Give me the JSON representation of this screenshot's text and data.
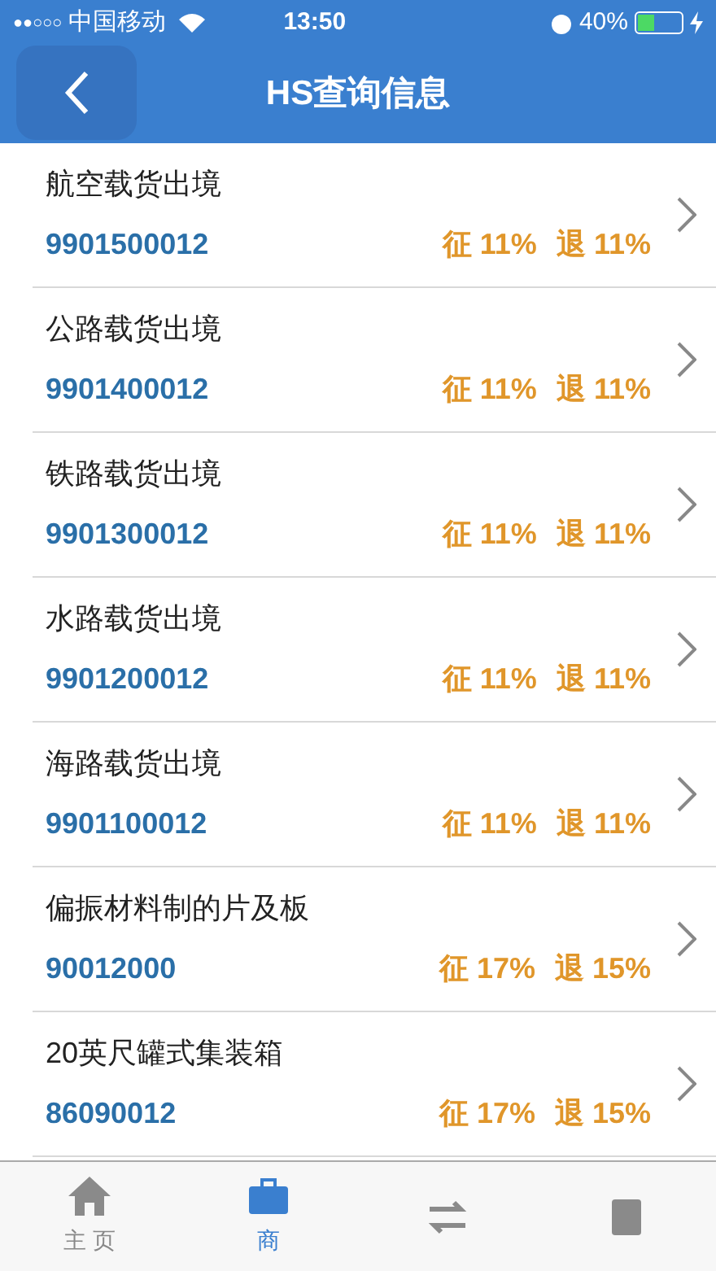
{
  "status_bar": {
    "signal": "●●○○○",
    "carrier": "中国移动",
    "time": "13:50",
    "battery": "40%",
    "battery_gauge": {
      "level": 0.4
    }
  },
  "nav": {
    "title": "HS查询信息"
  },
  "items": [
    {
      "name": "航空载货出境",
      "code": "9901500012",
      "levy": "征 11%",
      "rebate": "退 11%"
    },
    {
      "name": "公路载货出境",
      "code": "9901400012",
      "levy": "征 11%",
      "rebate": "退 11%"
    },
    {
      "name": "铁路载货出境",
      "code": "9901300012",
      "levy": "征 11%",
      "rebate": "退 11%"
    },
    {
      "name": "水路载货出境",
      "code": "9901200012",
      "levy": "征 11%",
      "rebate": "退 11%"
    },
    {
      "name": "海路载货出境",
      "code": "9901100012",
      "levy": "征 11%",
      "rebate": "退 11%"
    },
    {
      "name": "偏振材料制的片及板",
      "code": "90012000",
      "levy": "征 17%",
      "rebate": "退 15%"
    },
    {
      "name": "20英尺罐式集装箱",
      "code": "86090012",
      "levy": "征 17%",
      "rebate": "退 15%"
    }
  ],
  "tabs": [
    {
      "label": "主 页",
      "kind": "home",
      "selected": false
    },
    {
      "label": "商",
      "kind": "briefcase",
      "selected": true
    },
    {
      "kind": "exchange",
      "selected": false
    },
    {
      "kind": "document",
      "selected": false
    }
  ]
}
